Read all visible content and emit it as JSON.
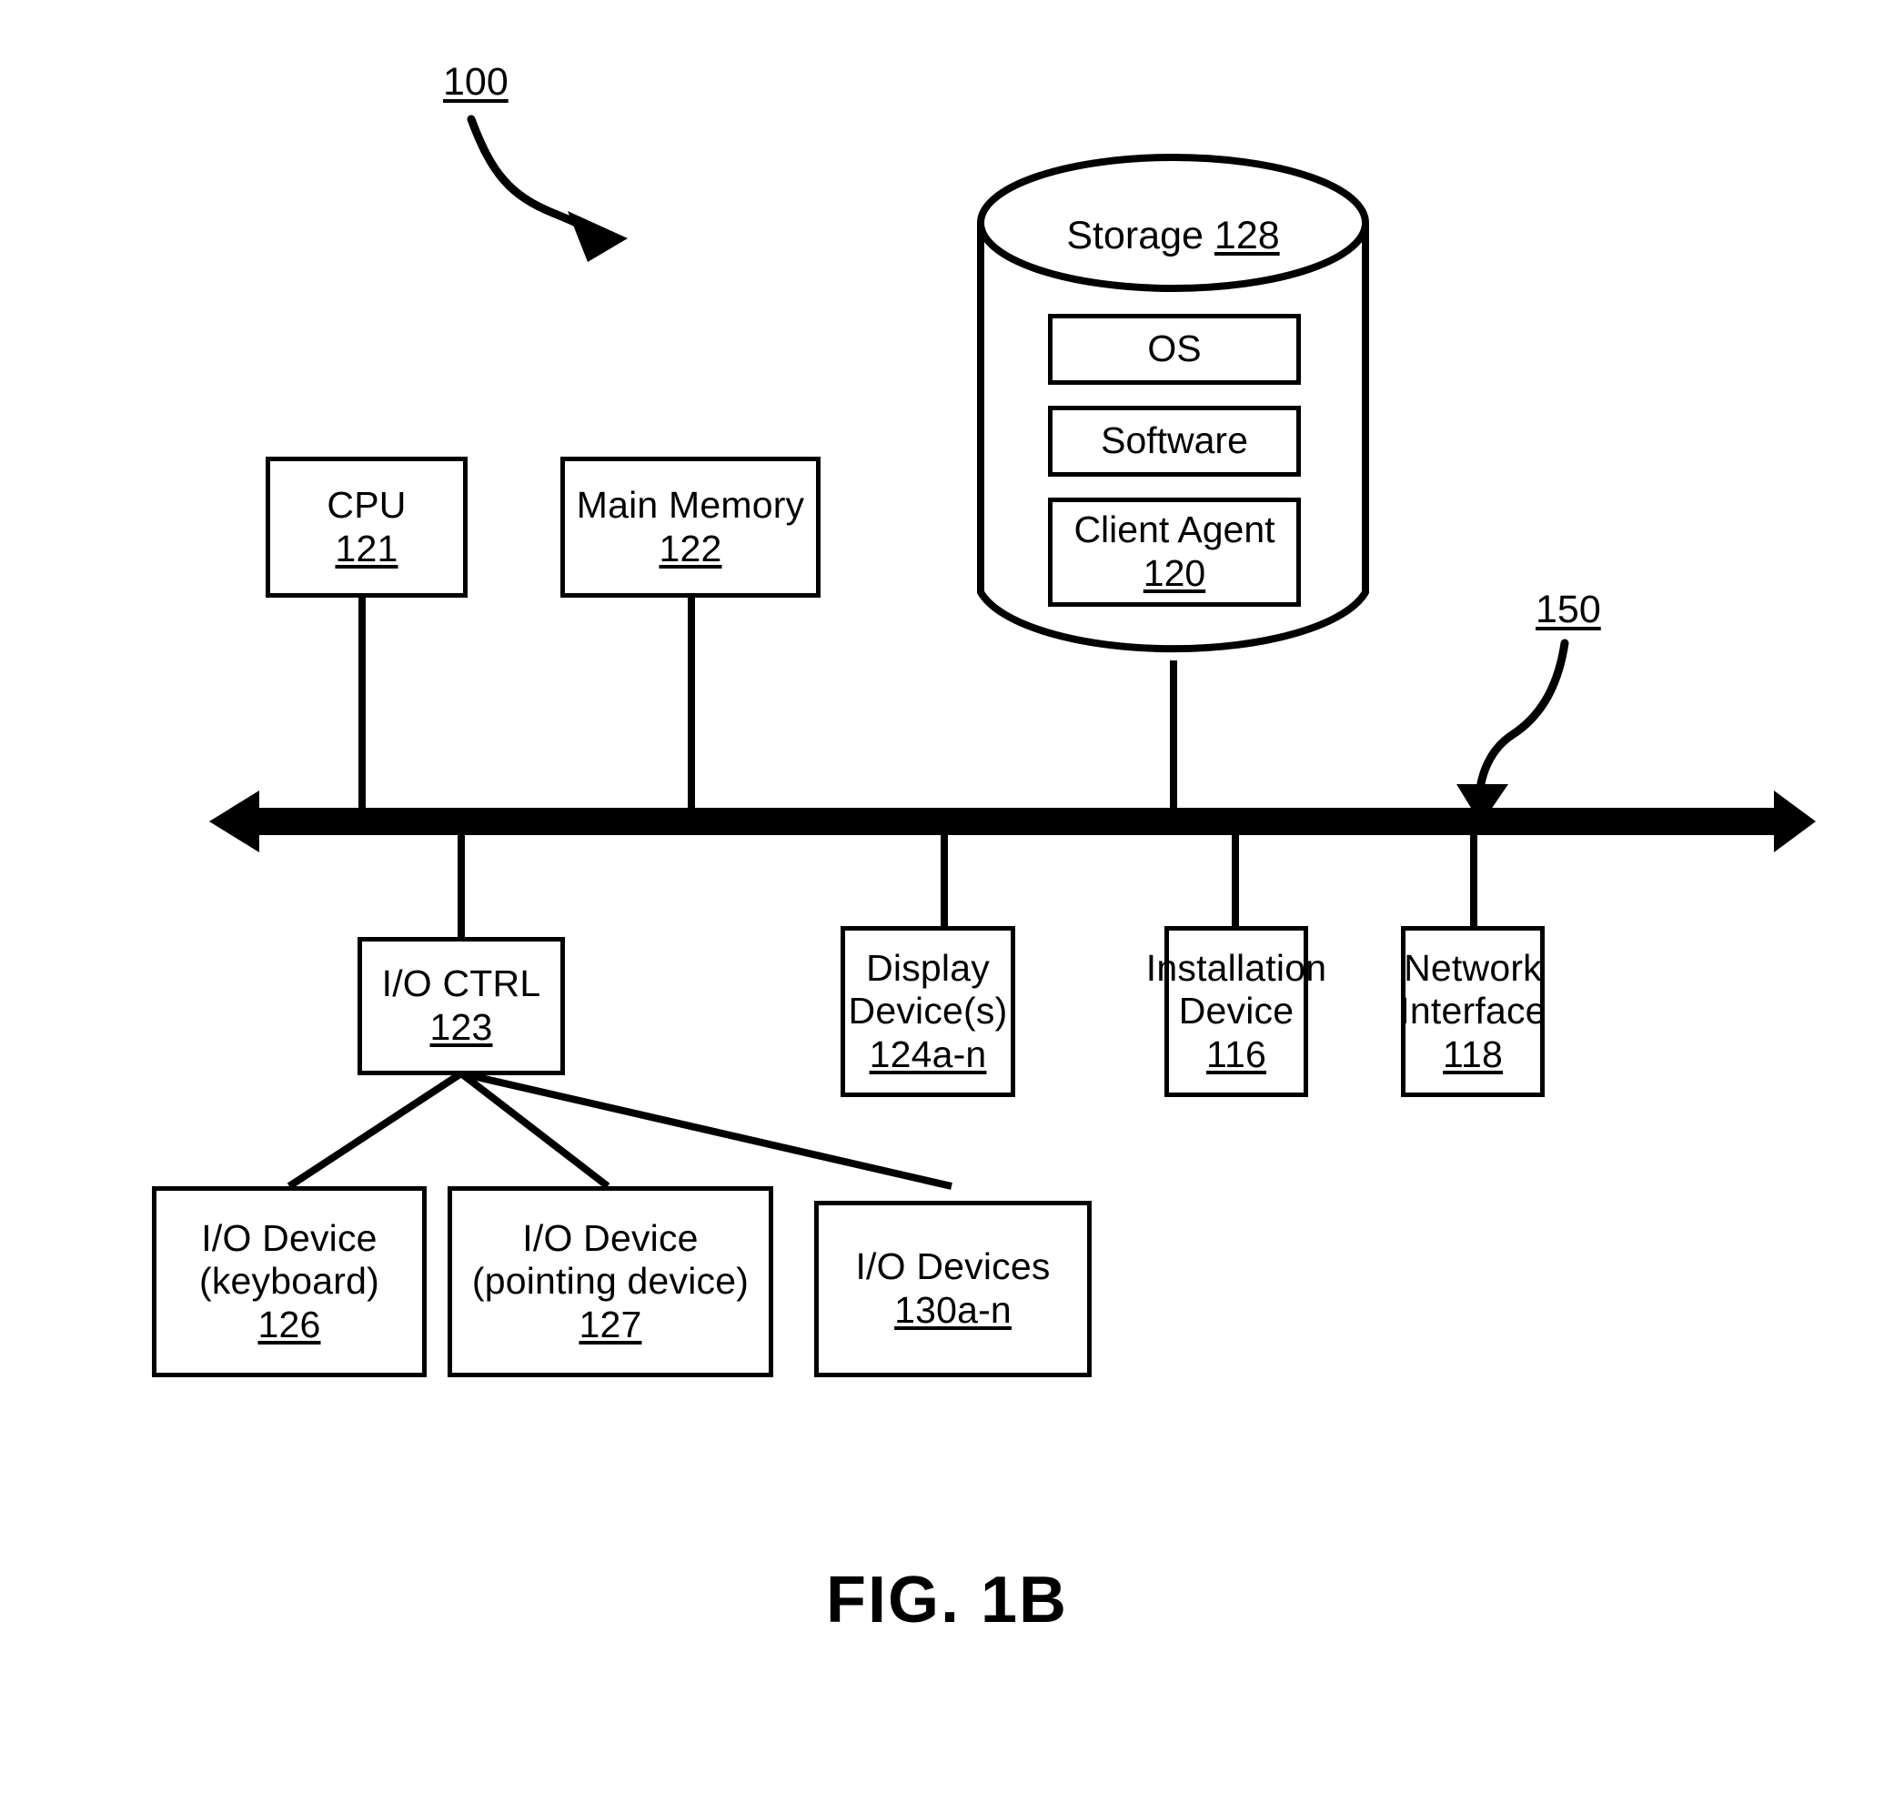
{
  "figure": {
    "caption": "FIG. 1B",
    "system_callout": "100",
    "bus_callout": "150"
  },
  "storage": {
    "title_text": "Storage",
    "title_num": "128",
    "items": [
      {
        "label": "OS",
        "num": ""
      },
      {
        "label": "Software",
        "num": ""
      },
      {
        "label": "Client Agent",
        "num": "120"
      }
    ]
  },
  "top_row": [
    {
      "label": "CPU",
      "num": "121"
    },
    {
      "label": "Main Memory",
      "num": "122"
    }
  ],
  "bottom_row": [
    {
      "line1": "I/O CTRL",
      "line2": "",
      "num": "123"
    },
    {
      "line1": "Display",
      "line2": "Device(s)",
      "num": "124a-n"
    },
    {
      "line1": "Installation",
      "line2": "Device",
      "num": "116"
    },
    {
      "line1": "Network",
      "line2": "Interface",
      "num": "118"
    }
  ],
  "io_devices": [
    {
      "line1": "I/O Device",
      "line2": "(keyboard)",
      "num": "126"
    },
    {
      "line1": "I/O Device",
      "line2": "(pointing device)",
      "num": "127"
    },
    {
      "line1": "I/O Devices",
      "line2": "",
      "num": "130a-n"
    }
  ],
  "colors": {
    "ink": "#000000",
    "paper": "#ffffff"
  }
}
